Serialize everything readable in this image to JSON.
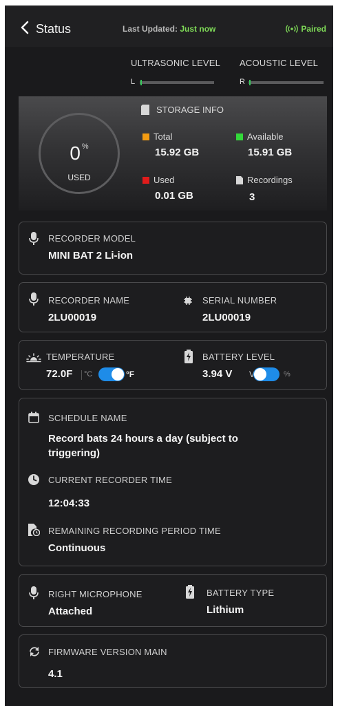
{
  "header": {
    "back_label": "Status",
    "last_updated_label": "Last Updated:",
    "last_updated_value": "Just now",
    "paired_label": "Paired"
  },
  "levels": {
    "ultrasonic_label": "ULTRASONIC LEVEL",
    "ultrasonic_channel": "L",
    "acoustic_label": "ACOUSTIC LEVEL",
    "acoustic_channel": "R"
  },
  "storage": {
    "used_percent": "0",
    "percent_symbol": "%",
    "used_label": "USED",
    "title": "STORAGE INFO",
    "total_label": "Total",
    "total_value": "15.92 GB",
    "available_label": "Available",
    "available_value": "15.91 GB",
    "used_item_label": "Used",
    "used_value": "0.01 GB",
    "recordings_label": "Recordings",
    "recordings_value": "3",
    "colors": {
      "total": "#f39c12",
      "available": "#33d93a",
      "used": "#e01b1b"
    }
  },
  "recorder_model": {
    "label": "RECORDER MODEL",
    "value": "MINI BAT 2 Li-ion"
  },
  "recorder_name": {
    "label": "RECORDER NAME",
    "value": "2LU00019"
  },
  "serial_number": {
    "label": "SERIAL NUMBER",
    "value": "2LU00019"
  },
  "temperature": {
    "label": "TEMPERATURE",
    "value": "72.0F",
    "unit_c": "°C",
    "unit_f": "°F",
    "unit_toggle_on": true
  },
  "battery_level": {
    "label": "BATTERY LEVEL",
    "value": "3.94 V",
    "unit_v": "V",
    "unit_pct": "%",
    "unit_toggle_on": true
  },
  "schedule": {
    "label": "SCHEDULE NAME",
    "value_line1": "Record bats 24 hours a day (subject to",
    "value_line2": "triggering)",
    "time_label": "CURRENT RECORDER TIME",
    "time_value": "12:04:33",
    "remaining_label": "REMAINING RECORDING PERIOD TIME",
    "remaining_value": "Continuous"
  },
  "right_microphone": {
    "label": "RIGHT MICROPHONE",
    "value": "Attached"
  },
  "battery_type": {
    "label": "BATTERY TYPE",
    "value": "Lithium"
  },
  "firmware": {
    "label": "FIRMWARE VERSION MAIN",
    "value": "4.1"
  },
  "colors": {
    "background": "#1a1a1c",
    "accent_green": "#7ed957",
    "toggle_blue": "#1e8ce8"
  }
}
